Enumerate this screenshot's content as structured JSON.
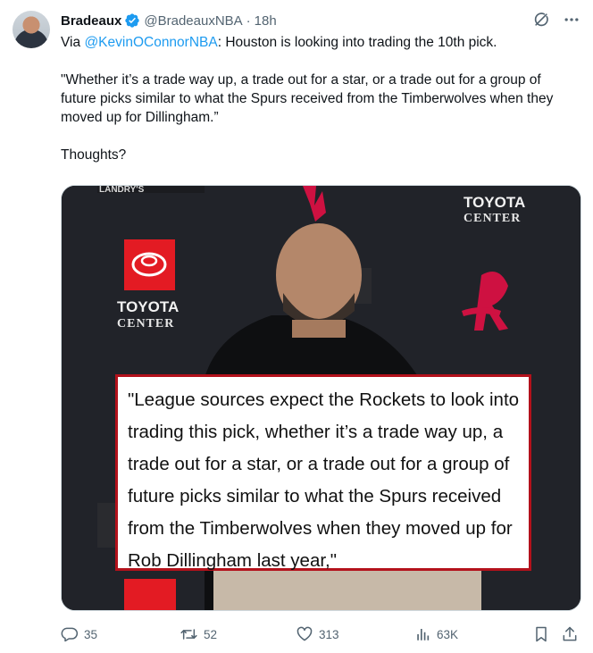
{
  "tweet": {
    "author_name": "Bradeaux",
    "author_handle": "@BradeauxNBA",
    "separator": "·",
    "time": "18h",
    "text_prefix": "Via ",
    "mention": "@KevinOConnorNBA",
    "text_line1_rest": ": Houston is looking into trading the 10th pick.",
    "quote_paragraph": "\"Whether it’s a trade way up, a trade out for a star, or a trade out for a group of future picks similar to what the Spurs received from the Timberwolves when they moved up for Dillingham.”",
    "closing": "Thoughts?"
  },
  "media": {
    "sponsor_top": "TOYOTA",
    "sponsor_bottom": "CENTER",
    "sponsor_left_top": "TOYOTA",
    "sponsor_left_bottom": "CENTER",
    "banner_top": "LANDRY'S",
    "quote_text": "\"League sources expect the Rockets to look into trading this pick, whether it’s a trade way up, a trade out for a star, or a trade out for a group of future picks similar to what the Spurs received from the Timberwolves when they moved up for Rob Dillingham last year,\""
  },
  "actions": {
    "replies": "35",
    "reposts": "52",
    "likes": "313",
    "views": "63K"
  },
  "colors": {
    "accent": "#1d9bf0",
    "muted": "#536471",
    "quote_border": "#b3111b"
  }
}
